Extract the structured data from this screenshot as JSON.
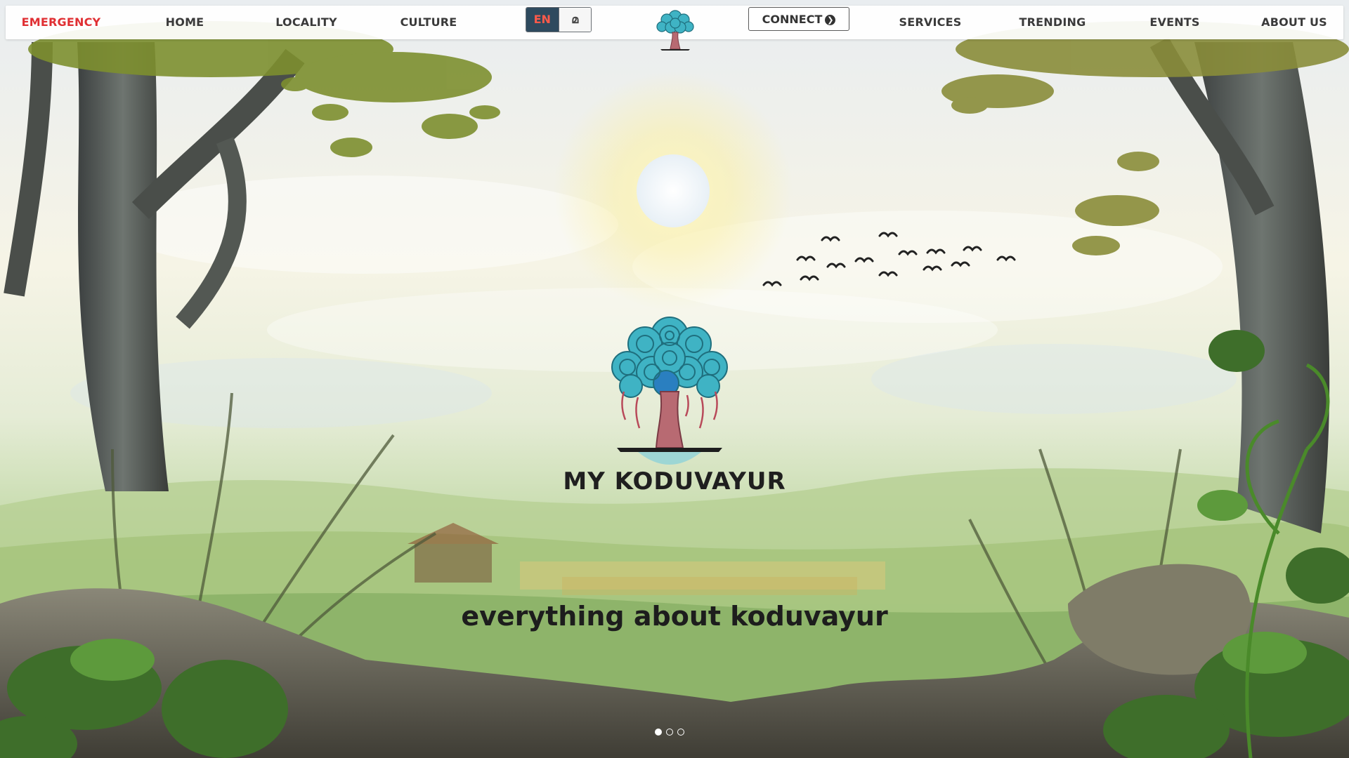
{
  "nav": {
    "left": [
      {
        "name": "nav-emergency",
        "label": "EMERGENCY"
      },
      {
        "name": "nav-home",
        "label": "HOME"
      },
      {
        "name": "nav-locality",
        "label": "LOCALITY"
      },
      {
        "name": "nav-culture",
        "label": "CULTURE"
      }
    ],
    "right": [
      {
        "name": "nav-services",
        "label": "SERVICES"
      },
      {
        "name": "nav-trending",
        "label": "TRENDING"
      },
      {
        "name": "nav-events",
        "label": "EVENTS"
      },
      {
        "name": "nav-about-us",
        "label": "ABOUT US"
      }
    ],
    "language": {
      "active": "EN",
      "alternate": "മ"
    },
    "connect_label": "CONNECT",
    "connect_icon": "chevron-circle-right-icon"
  },
  "hero": {
    "brand_name": "MY KODUVAYUR",
    "tagline": "everything about koduvayur",
    "slides_total": 3,
    "active_slide": 1
  },
  "colors": {
    "emergency": "#e02f33",
    "nav_text": "#3a3a3a",
    "lang_active_bg": "#2e4a5e",
    "lang_active_text": "#ff5a4a",
    "tree_canopy": "#3fb3c4",
    "tree_trunk": "#b86a72"
  }
}
